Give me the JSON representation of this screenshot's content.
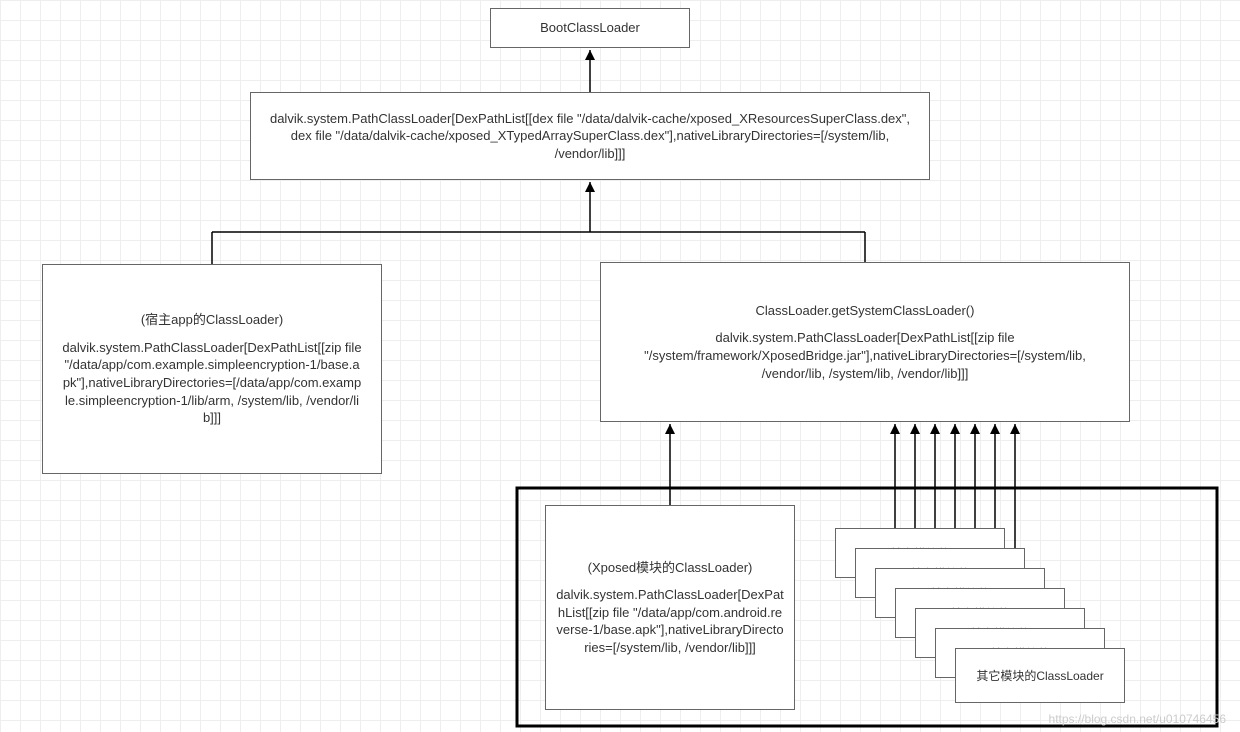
{
  "nodes": {
    "boot": {
      "text": "BootClassLoader"
    },
    "pathTop": {
      "text": "dalvik.system.PathClassLoader[DexPathList[[dex file \"/data/dalvik-cache/xposed_XResourcesSuperClass.dex\", dex file \"/data/dalvik-cache/xposed_XTypedArraySuperClass.dex\"],nativeLibraryDirectories=[/system/lib, /vendor/lib]]]"
    },
    "hostApp": {
      "title": "(宿主app的ClassLoader)",
      "text": "dalvik.system.PathClassLoader[DexPathList[[zip file \"/data/app/com.example.simpleencryption-1/base.apk\"],nativeLibraryDirectories=[/data/app/com.example.simpleencryption-1/lib/arm, /system/lib, /vendor/lib]]]"
    },
    "system": {
      "title": "ClassLoader.getSystemClassLoader()",
      "text": "dalvik.system.PathClassLoader[DexPathList[[zip file \"/system/framework/XposedBridge.jar\"],nativeLibraryDirectories=[/system/lib, /vendor/lib, /system/lib, /vendor/lib]]]"
    },
    "xposedModule": {
      "title": "(Xposed模块的ClassLoader)",
      "text": "dalvik.system.PathClassLoader[DexPathList[[zip file \"/data/app/com.android.reverse-1/base.apk\"],nativeLibraryDirectories=[/system/lib, /vendor/lib]]]"
    },
    "otherModule": {
      "text": "其它模块的ClassLoader"
    },
    "otherModulePartial": {
      "text": "其它模块的"
    }
  },
  "watermark": "https://blog.csdn.net/u010746456"
}
